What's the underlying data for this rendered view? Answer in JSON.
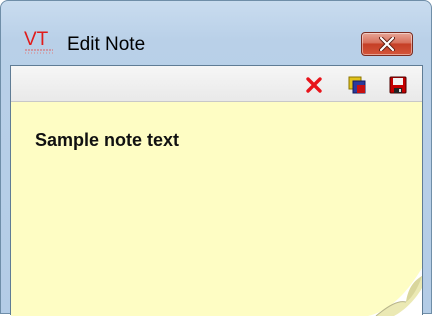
{
  "window": {
    "title": "Edit Note",
    "logo_text": "VT"
  },
  "toolbar": {
    "buttons": [
      {
        "icon": "delete-x-icon",
        "color": "#e8141b"
      },
      {
        "icon": "color-palette-icon",
        "color": "#d4b400"
      },
      {
        "icon": "save-disk-icon",
        "color": "#c40000"
      }
    ]
  },
  "note": {
    "text": "Sample note text",
    "background": "#fefdc4"
  },
  "colors": {
    "close_button": "#c53f26",
    "titlebar": "#c9dcef"
  }
}
